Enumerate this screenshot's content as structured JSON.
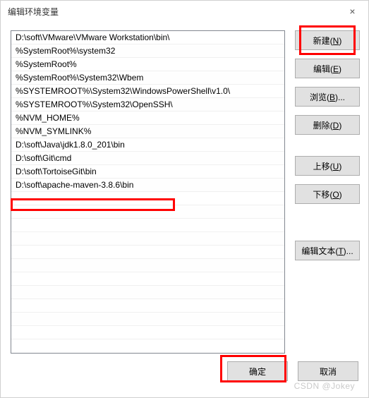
{
  "title": "编辑环境变量",
  "close_label": "×",
  "paths": [
    "D:\\soft\\VMware\\VMware Workstation\\bin\\",
    "%SystemRoot%\\system32",
    "%SystemRoot%",
    "%SystemRoot%\\System32\\Wbem",
    "%SYSTEMROOT%\\System32\\WindowsPowerShell\\v1.0\\",
    "%SYSTEMROOT%\\System32\\OpenSSH\\",
    "%NVM_HOME%",
    "%NVM_SYMLINK%",
    "D:\\soft\\Java\\jdk1.8.0_201\\bin",
    "D:\\soft\\Git\\cmd",
    "D:\\soft\\TortoiseGit\\bin",
    "D:\\soft\\apache-maven-3.8.6\\bin"
  ],
  "buttons": {
    "new": "新建(N)",
    "edit": "编辑(E)",
    "browse": "浏览(B)...",
    "delete": "删除(D)",
    "move_up": "上移(U)",
    "move_down": "下移(O)",
    "edit_text": "编辑文本(T)...",
    "ok": "确定",
    "cancel": "取消"
  },
  "highlight": {
    "color": "#ff0000",
    "targets": [
      "new-button",
      "path-row-11",
      "ok-button"
    ]
  },
  "watermark": "CSDN @Jokey"
}
